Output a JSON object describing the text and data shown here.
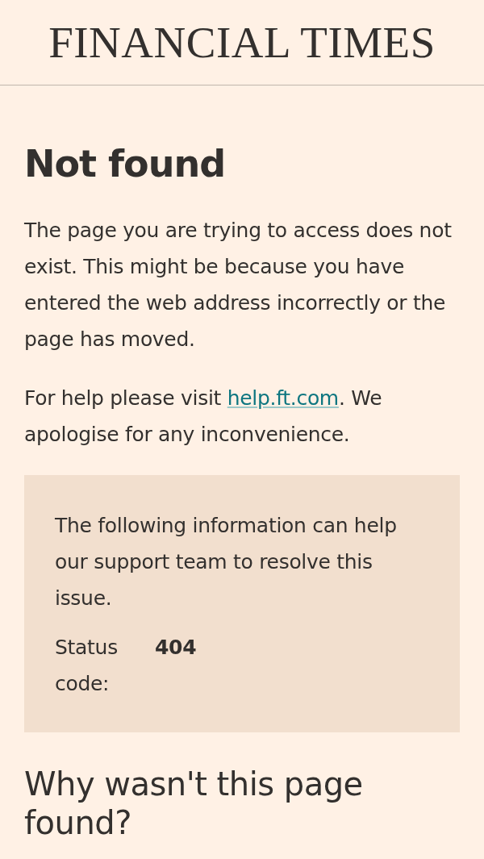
{
  "header": {
    "logo": "FINANCIAL TIMES"
  },
  "title": "Not found",
  "paragraphs": [
    "The page you are trying to access does not exist. This might be because you have entered the web address incorrectly or the page has moved."
  ],
  "help": {
    "before": "For help please visit ",
    "link": "help.ft.com",
    "after": ". We apologise for any inconvenience."
  },
  "support_box": {
    "intro": "The following information can help our support team to resolve this issue.",
    "fields": [
      {
        "label": "Status code:",
        "value": "404"
      }
    ]
  },
  "section_heading": "Why wasn't this page found?"
}
